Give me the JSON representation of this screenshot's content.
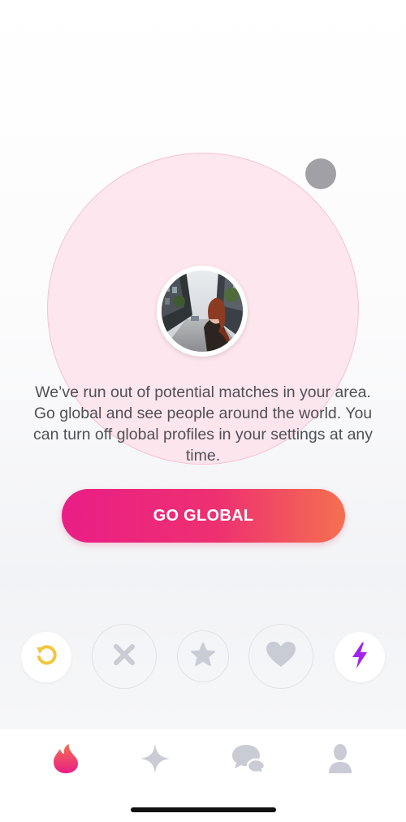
{
  "discovery": {
    "message": "We’ve run out of potential matches in your area. Go global and see people around the world. You can turn off global profiles in your settings at any time.",
    "cta_label": "GO GLOBAL"
  },
  "colors": {
    "brand_gradient_start": "#ea1e86",
    "brand_gradient_end": "#f4704f",
    "radar_fill": "#fddee8",
    "rewind_yellow": "#f3c440",
    "boost_purple": "#a322f0",
    "inactive_gray": "#c9ccd4"
  },
  "action_bar": {
    "buttons": [
      {
        "id": "rewind",
        "icon": "rewind-icon"
      },
      {
        "id": "nope",
        "icon": "x-icon"
      },
      {
        "id": "super-like",
        "icon": "star-icon"
      },
      {
        "id": "like",
        "icon": "heart-icon"
      },
      {
        "id": "boost",
        "icon": "lightning-icon"
      }
    ]
  },
  "tab_bar": {
    "tabs": [
      {
        "id": "discover",
        "icon": "flame-icon",
        "active": true
      },
      {
        "id": "top-picks",
        "icon": "sparkle-icon",
        "active": false
      },
      {
        "id": "messages",
        "icon": "chat-bubbles-icon",
        "active": false
      },
      {
        "id": "profile",
        "icon": "person-icon",
        "active": false
      }
    ]
  }
}
